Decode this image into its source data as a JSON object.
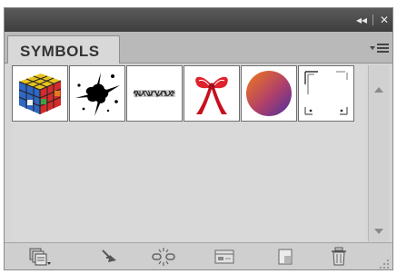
{
  "panel": {
    "tab_label": "SYMBOLS",
    "titlebar": {
      "collapse_glyph": "◂◂",
      "close_glyph": "✕"
    }
  },
  "symbols": [
    {
      "name": "rubiks-cube-symbol",
      "icon": "cube"
    },
    {
      "name": "splatter-symbol",
      "icon": "splat"
    },
    {
      "name": "scribble-text-symbol",
      "icon": "scribble"
    },
    {
      "name": "red-ribbon-bow-symbol",
      "icon": "bow"
    },
    {
      "name": "gradient-sphere-symbol",
      "icon": "sphere"
    },
    {
      "name": "corner-frame-symbol",
      "icon": "frame"
    }
  ],
  "footer_icons": [
    "symbol-libraries-menu-icon",
    "place-symbol-instance-icon",
    "break-link-icon",
    "symbol-options-icon",
    "new-symbol-icon",
    "delete-symbol-icon"
  ],
  "colors": {
    "titlebar": "#4a4a4a",
    "panel_bg": "#d9d9d9",
    "tab_bg": "#d8d8d8"
  }
}
